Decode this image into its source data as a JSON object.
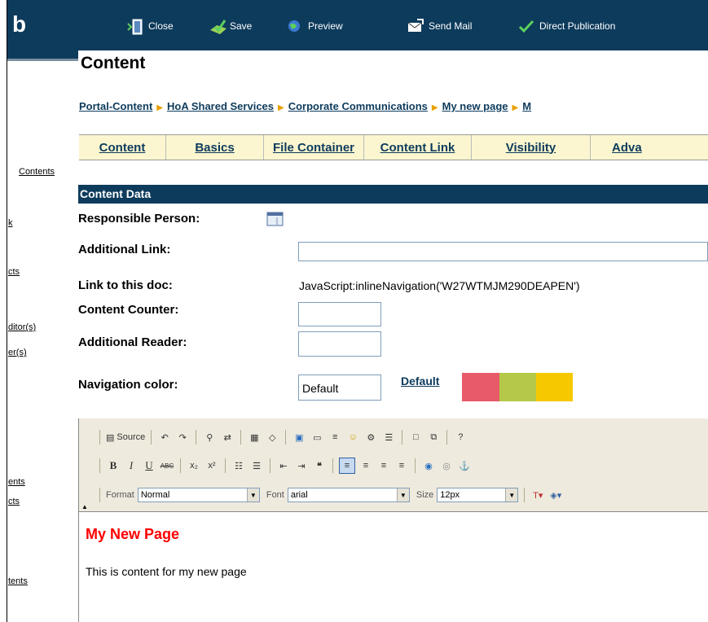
{
  "logo": "b",
  "sidebar": {
    "links": [
      "Contents",
      "k",
      "cts",
      "ditor(s)",
      "er(s)",
      "ents",
      "cts",
      "tents"
    ]
  },
  "toolbar": {
    "close": "Close",
    "save": "Save",
    "preview": "Preview",
    "send_mail": "Send Mail",
    "direct_publication": "Direct Publication"
  },
  "page_title": "Content",
  "breadcrumb": [
    "Portal-Content",
    "HoA Shared Services",
    "Corporate Communications",
    "My new page",
    "M"
  ],
  "tabs": [
    "Content",
    "Basics",
    "File Container",
    "Content Link",
    "Visibility",
    "Adva"
  ],
  "section": "Content Data",
  "fields": {
    "responsible_person": "Responsible Person:",
    "additional_link": "Additional Link:",
    "link_to_doc": "Link to this doc:",
    "link_to_doc_value": "JavaScript:inlineNavigation('W27WTMJM290DEAPEN')",
    "content_counter": "Content Counter:",
    "additional_reader": "Additional Reader:",
    "navigation_color": "Navigation color:",
    "navigation_color_value": "Default",
    "default_link": "Default"
  },
  "swatches": [
    "#e85a6a",
    "#b5c84a",
    "#f5c800"
  ],
  "editor": {
    "source": "Source",
    "format_label": "Format",
    "format_value": "Normal",
    "font_label": "Font",
    "font_value": "arial",
    "size_label": "Size",
    "size_value": "12px",
    "content_title": "My New Page",
    "content_text": "This is content for my new page"
  }
}
